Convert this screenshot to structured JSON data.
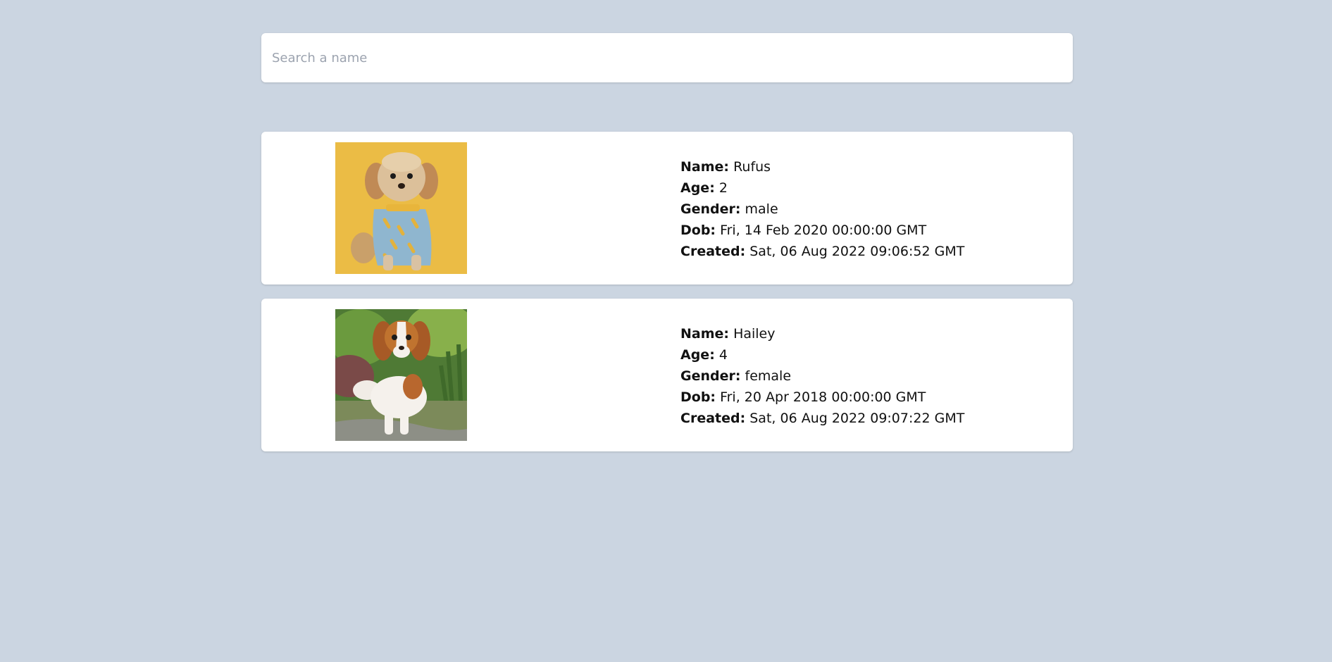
{
  "search": {
    "placeholder": "Search a name",
    "value": ""
  },
  "labels": {
    "name": "Name:",
    "age": "Age:",
    "gender": "Gender:",
    "dob": "Dob:",
    "created": "Created:"
  },
  "pets": [
    {
      "name": "Rufus",
      "age": "2",
      "gender": "male",
      "dob": "Fri, 14 Feb 2020 00:00:00 GMT",
      "created": "Sat, 06 Aug 2022 09:06:52 GMT",
      "photo": "small shaggy dog in blue shirt on yellow background"
    },
    {
      "name": "Hailey",
      "age": "4",
      "gender": "female",
      "dob": "Fri, 20 Apr 2018 00:00:00 GMT",
      "created": "Sat, 06 Aug 2022 09:07:22 GMT",
      "photo": "cavalier spaniel standing on garden path"
    }
  ],
  "colors": {
    "background": "#cbd5e1",
    "card": "#ffffff",
    "placeholder": "#9ca3af"
  }
}
